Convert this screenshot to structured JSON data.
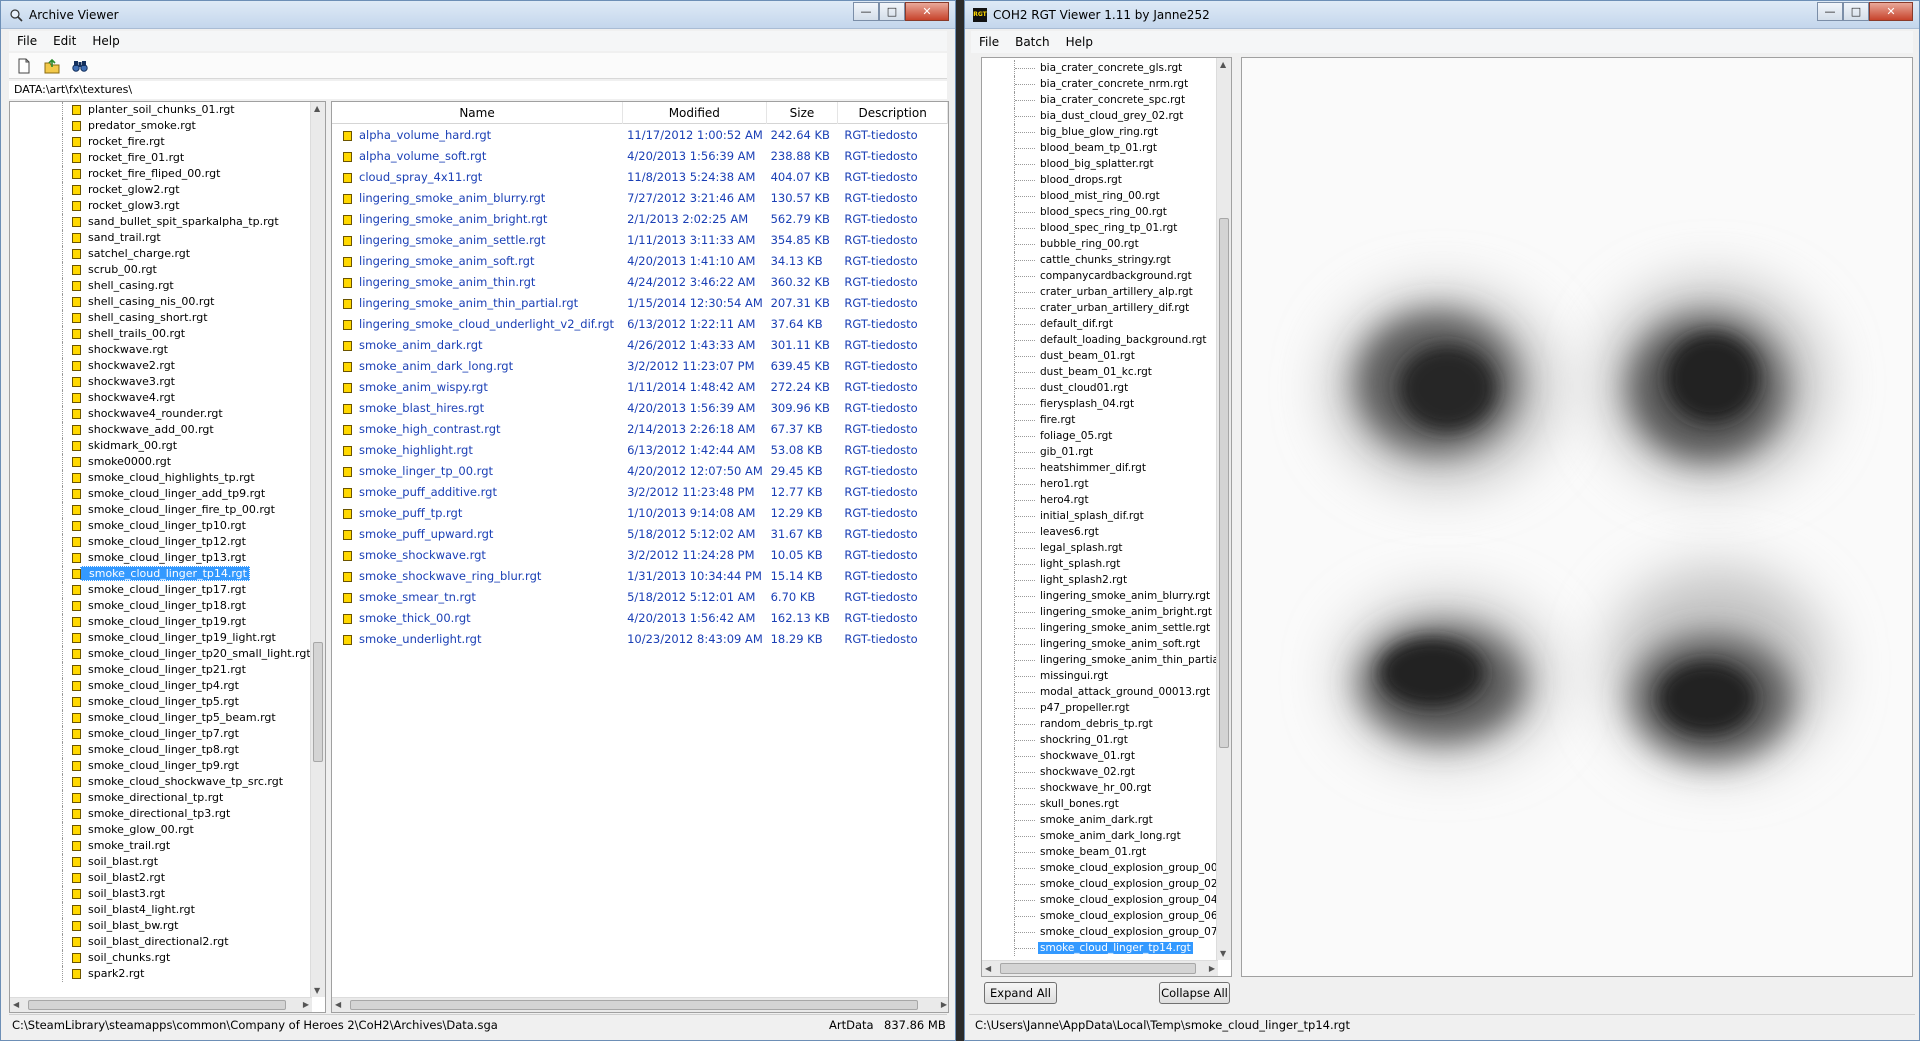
{
  "archive_viewer": {
    "title": "Archive Viewer",
    "menu": [
      "File",
      "Edit",
      "Help"
    ],
    "path": "DATA:\\art\\fx\\textures\\",
    "tree_items": [
      "planter_soil_chunks_01.rgt",
      "predator_smoke.rgt",
      "rocket_fire.rgt",
      "rocket_fire_01.rgt",
      "rocket_fire_fliped_00.rgt",
      "rocket_glow2.rgt",
      "rocket_glow3.rgt",
      "sand_bullet_spit_sparkalpha_tp.rgt",
      "sand_trail.rgt",
      "satchel_charge.rgt",
      "scrub_00.rgt",
      "shell_casing.rgt",
      "shell_casing_nis_00.rgt",
      "shell_casing_short.rgt",
      "shell_trails_00.rgt",
      "shockwave.rgt",
      "shockwave2.rgt",
      "shockwave3.rgt",
      "shockwave4.rgt",
      "shockwave4_rounder.rgt",
      "shockwave_add_00.rgt",
      "skidmark_00.rgt",
      "smoke0000.rgt",
      "smoke_cloud_highlights_tp.rgt",
      "smoke_cloud_linger_add_tp9.rgt",
      "smoke_cloud_linger_fire_tp_00.rgt",
      "smoke_cloud_linger_tp10.rgt",
      "smoke_cloud_linger_tp12.rgt",
      "smoke_cloud_linger_tp13.rgt",
      "smoke_cloud_linger_tp14.rgt",
      "smoke_cloud_linger_tp17.rgt",
      "smoke_cloud_linger_tp18.rgt",
      "smoke_cloud_linger_tp19.rgt",
      "smoke_cloud_linger_tp19_light.rgt",
      "smoke_cloud_linger_tp20_small_light.rgt",
      "smoke_cloud_linger_tp21.rgt",
      "smoke_cloud_linger_tp4.rgt",
      "smoke_cloud_linger_tp5.rgt",
      "smoke_cloud_linger_tp5_beam.rgt",
      "smoke_cloud_linger_tp7.rgt",
      "smoke_cloud_linger_tp8.rgt",
      "smoke_cloud_linger_tp9.rgt",
      "smoke_cloud_shockwave_tp_src.rgt",
      "smoke_directional_tp.rgt",
      "smoke_directional_tp3.rgt",
      "smoke_glow_00.rgt",
      "smoke_trail.rgt",
      "soil_blast.rgt",
      "soil_blast2.rgt",
      "soil_blast3.rgt",
      "soil_blast4_light.rgt",
      "soil_blast_bw.rgt",
      "soil_blast_directional2.rgt",
      "soil_chunks.rgt",
      "spark2.rgt"
    ],
    "selected_tree_item": "smoke_cloud_linger_tp14.rgt",
    "columns": [
      "Name",
      "Modified",
      "Size",
      "Description"
    ],
    "files": [
      [
        "alpha_volume_hard.rgt",
        "11/17/2012 1:00:52 AM",
        "242.64 KB",
        "RGT-tiedosto"
      ],
      [
        "alpha_volume_soft.rgt",
        "4/20/2013 1:56:39 AM",
        "238.88 KB",
        "RGT-tiedosto"
      ],
      [
        "cloud_spray_4x11.rgt",
        "11/8/2013 5:24:38 AM",
        "404.07 KB",
        "RGT-tiedosto"
      ],
      [
        "lingering_smoke_anim_blurry.rgt",
        "7/27/2012 3:21:46 AM",
        "130.57 KB",
        "RGT-tiedosto"
      ],
      [
        "lingering_smoke_anim_bright.rgt",
        "2/1/2013 2:02:25 AM",
        "562.79 KB",
        "RGT-tiedosto"
      ],
      [
        "lingering_smoke_anim_settle.rgt",
        "1/11/2013 3:11:33 AM",
        "354.85 KB",
        "RGT-tiedosto"
      ],
      [
        "lingering_smoke_anim_soft.rgt",
        "4/20/2013 1:41:10 AM",
        "34.13 KB",
        "RGT-tiedosto"
      ],
      [
        "lingering_smoke_anim_thin.rgt",
        "4/24/2012 3:46:22 AM",
        "360.32 KB",
        "RGT-tiedosto"
      ],
      [
        "lingering_smoke_anim_thin_partial.rgt",
        "1/15/2014 12:30:54 AM",
        "207.31 KB",
        "RGT-tiedosto"
      ],
      [
        "lingering_smoke_cloud_underlight_v2_dif.rgt",
        "6/13/2012 1:22:11 AM",
        "37.64 KB",
        "RGT-tiedosto"
      ],
      [
        "smoke_anim_dark.rgt",
        "4/26/2012 1:43:33 AM",
        "301.11 KB",
        "RGT-tiedosto"
      ],
      [
        "smoke_anim_dark_long.rgt",
        "3/2/2012 11:23:07 PM",
        "639.45 KB",
        "RGT-tiedosto"
      ],
      [
        "smoke_anim_wispy.rgt",
        "1/11/2014 1:48:42 AM",
        "272.24 KB",
        "RGT-tiedosto"
      ],
      [
        "smoke_blast_hires.rgt",
        "4/20/2013 1:56:39 AM",
        "309.96 KB",
        "RGT-tiedosto"
      ],
      [
        "smoke_high_contrast.rgt",
        "2/14/2013 2:26:18 AM",
        "67.37 KB",
        "RGT-tiedosto"
      ],
      [
        "smoke_highlight.rgt",
        "6/13/2012 1:42:44 AM",
        "53.08 KB",
        "RGT-tiedosto"
      ],
      [
        "smoke_linger_tp_00.rgt",
        "4/20/2012 12:07:50 AM",
        "29.45 KB",
        "RGT-tiedosto"
      ],
      [
        "smoke_puff_additive.rgt",
        "3/2/2012 11:23:48 PM",
        "12.77 KB",
        "RGT-tiedosto"
      ],
      [
        "smoke_puff_tp.rgt",
        "1/10/2013 9:14:08 AM",
        "12.29 KB",
        "RGT-tiedosto"
      ],
      [
        "smoke_puff_upward.rgt",
        "5/18/2012 5:12:02 AM",
        "31.67 KB",
        "RGT-tiedosto"
      ],
      [
        "smoke_shockwave.rgt",
        "3/2/2012 11:24:28 PM",
        "10.05 KB",
        "RGT-tiedosto"
      ],
      [
        "smoke_shockwave_ring_blur.rgt",
        "1/31/2013 10:34:44 PM",
        "15.14 KB",
        "RGT-tiedosto"
      ],
      [
        "smoke_smear_tn.rgt",
        "5/18/2012 5:12:01 AM",
        "6.70 KB",
        "RGT-tiedosto"
      ],
      [
        "smoke_thick_00.rgt",
        "4/20/2013 1:56:42 AM",
        "162.13 KB",
        "RGT-tiedosto"
      ],
      [
        "smoke_underlight.rgt",
        "10/23/2012 8:43:09 AM",
        "18.29 KB",
        "RGT-tiedosto"
      ]
    ],
    "status": {
      "path": "C:\\SteamLibrary\\steamapps\\common\\Company of Heroes 2\\CoH2\\Archives\\Data.sga",
      "archive": "ArtData",
      "size": "837.86 MB"
    }
  },
  "rgt_viewer": {
    "title": "COH2 RGT Viewer 1.11 by Janne252",
    "icon_text": "RGT",
    "menu": [
      "File",
      "Batch",
      "Help"
    ],
    "tree_items": [
      "bia_crater_concrete_gls.rgt",
      "bia_crater_concrete_nrm.rgt",
      "bia_crater_concrete_spc.rgt",
      "bia_dust_cloud_grey_02.rgt",
      "big_blue_glow_ring.rgt",
      "blood_beam_tp_01.rgt",
      "blood_big_splatter.rgt",
      "blood_drops.rgt",
      "blood_mist_ring_00.rgt",
      "blood_specs_ring_00.rgt",
      "blood_spec_ring_tp_01.rgt",
      "bubble_ring_00.rgt",
      "cattle_chunks_stringy.rgt",
      "companycardbackground.rgt",
      "crater_urban_artillery_alp.rgt",
      "crater_urban_artillery_dif.rgt",
      "default_dif.rgt",
      "default_loading_background.rgt",
      "dust_beam_01.rgt",
      "dust_beam_01_kc.rgt",
      "dust_cloud01.rgt",
      "fierysplash_04.rgt",
      "fire.rgt",
      "foliage_05.rgt",
      "gib_01.rgt",
      "heatshimmer_dif.rgt",
      "hero1.rgt",
      "hero4.rgt",
      "initial_splash_dif.rgt",
      "leaves6.rgt",
      "legal_splash.rgt",
      "light_splash.rgt",
      "light_splash2.rgt",
      "lingering_smoke_anim_blurry.rgt",
      "lingering_smoke_anim_bright.rgt",
      "lingering_smoke_anim_settle.rgt",
      "lingering_smoke_anim_soft.rgt",
      "lingering_smoke_anim_thin_partial.rgt",
      "missingui.rgt",
      "modal_attack_ground_00013.rgt",
      "p47_propeller.rgt",
      "random_debris_tp.rgt",
      "shockring_01.rgt",
      "shockwave_01.rgt",
      "shockwave_02.rgt",
      "shockwave_hr_00.rgt",
      "skull_bones.rgt",
      "smoke_anim_dark.rgt",
      "smoke_anim_dark_long.rgt",
      "smoke_beam_01.rgt",
      "smoke_cloud_explosion_group_00.rgt",
      "smoke_cloud_explosion_group_02.rgt",
      "smoke_cloud_explosion_group_04.rgt",
      "smoke_cloud_explosion_group_06.rgt",
      "smoke_cloud_explosion_group_07.rgt",
      "smoke_cloud_linger_tp14.rgt"
    ],
    "selected_tree_item": "smoke_cloud_linger_tp14.rgt",
    "buttons": {
      "expand_all": "Expand All",
      "collapse_all": "Collapse All"
    },
    "status_path": "C:\\Users\\Janne\\AppData\\Local\\Temp\\smoke_cloud_linger_tp14.rgt"
  }
}
